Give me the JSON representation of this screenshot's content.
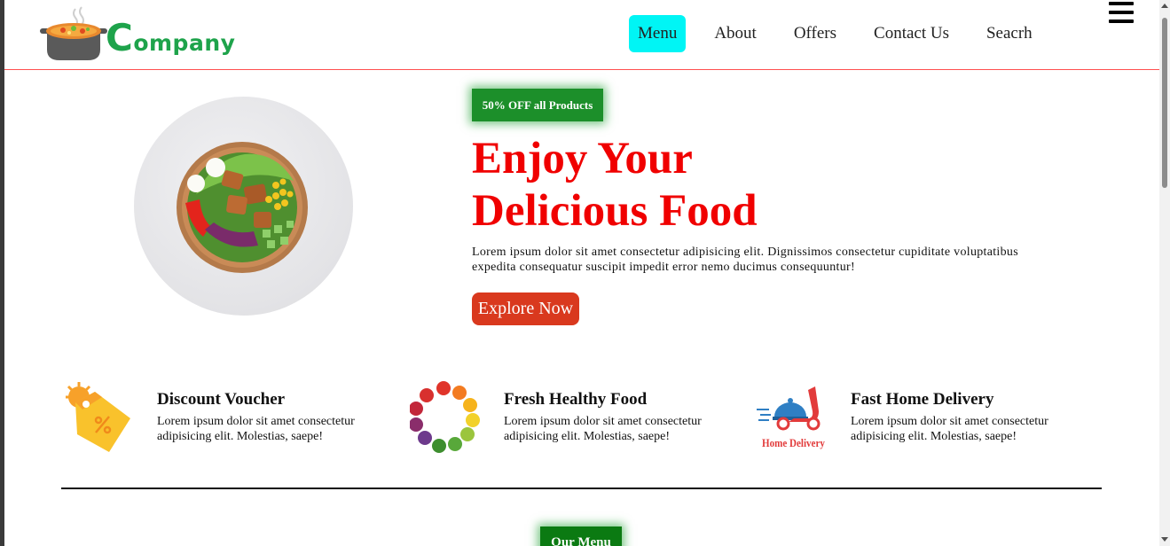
{
  "brand": {
    "logo_initial": "C",
    "logo_rest": "ompany"
  },
  "nav": {
    "items": [
      {
        "label": "Menu",
        "active": true
      },
      {
        "label": "About",
        "active": false
      },
      {
        "label": "Offers",
        "active": false
      },
      {
        "label": "Contact Us",
        "active": false
      },
      {
        "label": "Seacrh",
        "active": false
      }
    ],
    "menu_icon": "hamburger-icon"
  },
  "hero": {
    "badge": "50% OFF all Products",
    "title_line1": "Enjoy Your",
    "title_line2": "Delicious Food",
    "text": "Lorem ipsum dolor sit amet consectetur adipisicing elit. Dignissimos consectetur cupiditate voluptatibus expedita consequatur suscipit impedit error nemo ducimus consequuntur!",
    "cta": "Explore Now",
    "image": "salad-bowl-image"
  },
  "features": [
    {
      "icon": "discount-tag-icon",
      "title": "Discount Voucher",
      "text": "Lorem ipsum dolor sit amet consectetur adipisicing elit. Molestias, saepe!"
    },
    {
      "icon": "fresh-food-wreath-icon",
      "title": "Fresh Healthy Food",
      "text": "Lorem ipsum dolor sit amet consectetur adipisicing elit. Molestias, saepe!"
    },
    {
      "icon": "home-delivery-scooter-icon",
      "title": "Fast Home Delivery",
      "text": "Lorem ipsum dolor sit amet consectetur adipisicing elit. Molestias, saepe!",
      "icon_caption": "Home Delivery"
    }
  ],
  "section": {
    "our_menu": "Our Menu"
  },
  "colors": {
    "accent_cyan": "#00f5f5",
    "brand_green": "#1ea34b",
    "title_red": "#f00000",
    "cta_red": "#d9391e",
    "badge_green": "#1c8f2a"
  }
}
